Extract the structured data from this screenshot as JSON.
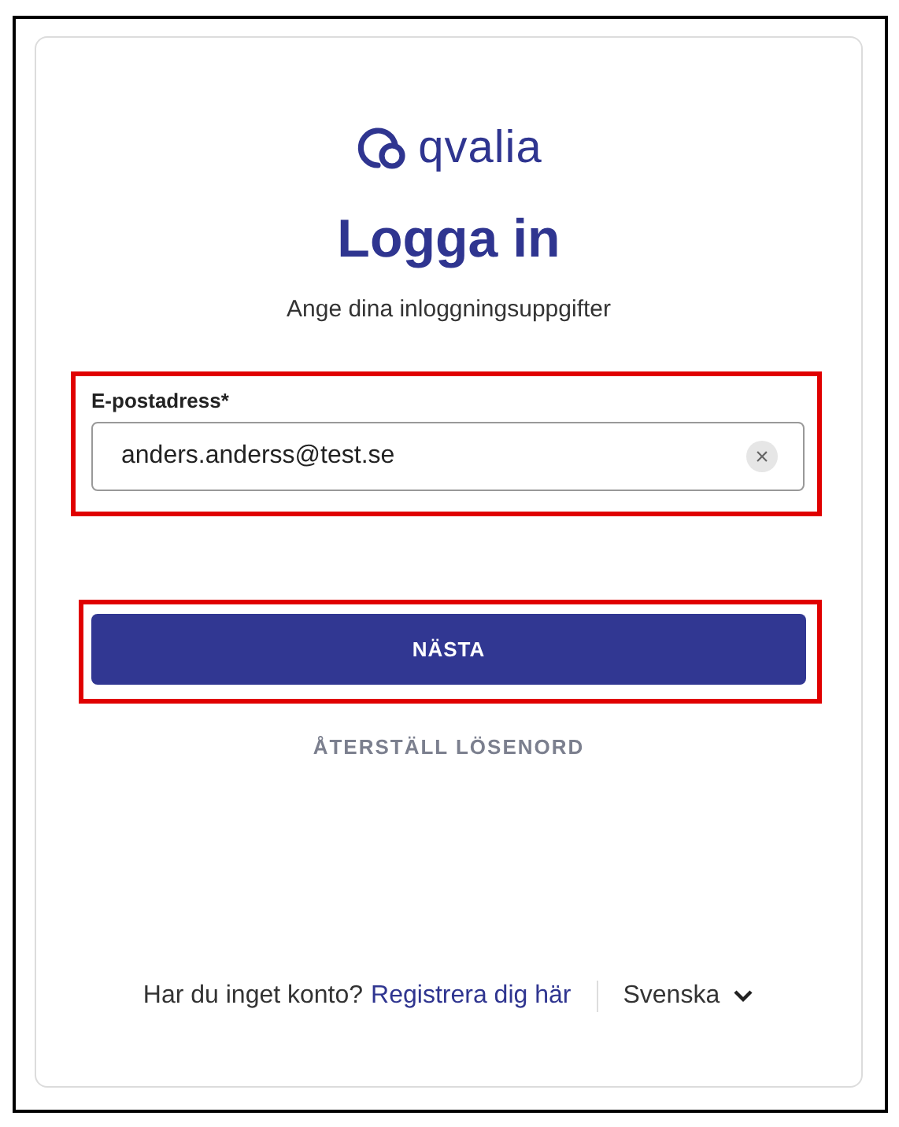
{
  "logo": {
    "text": "qvalia"
  },
  "title": "Logga in",
  "subtitle": "Ange dina inloggningsuppgifter",
  "email_field": {
    "label": "E-postadress*",
    "value": "anders.anderss@test.se",
    "clear_icon": "×"
  },
  "next_button": "NÄSTA",
  "reset_link": "ÅTERSTÄLL LÖSENORD",
  "footer": {
    "prompt": "Har du inget konto?",
    "register_link": "Registrera dig här",
    "language": "Svenska"
  }
}
